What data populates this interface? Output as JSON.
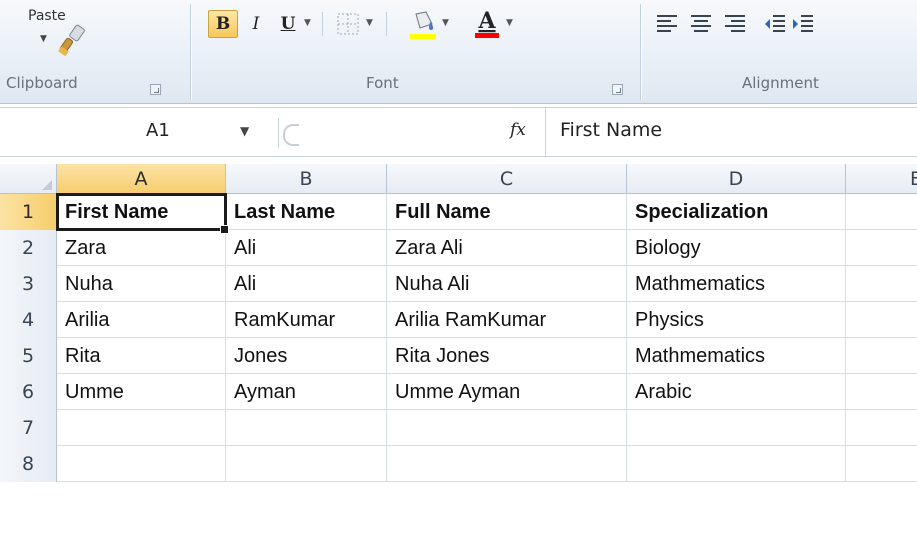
{
  "ribbon": {
    "clipboard": {
      "paste_label": "Paste",
      "group_label": "Clipboard"
    },
    "font": {
      "group_label": "Font",
      "bold": "B",
      "italic": "I",
      "underline": "U"
    },
    "alignment": {
      "group_label": "Alignment"
    },
    "icons": [
      "format-painter-icon",
      "borders-icon",
      "fill-color-icon",
      "font-color-icon",
      "align-left-icon",
      "align-center-icon",
      "align-right-icon",
      "decrease-indent-icon",
      "increase-indent-icon"
    ],
    "colors": {
      "fill_accent": "#ffff00",
      "font_color_accent": "#ff0000",
      "bold_active": "#f7c85b"
    }
  },
  "formula_bar": {
    "name_box": "A1",
    "fx_label": "fx",
    "value": "First Name"
  },
  "grid": {
    "columns": [
      "A",
      "B",
      "C",
      "D",
      "E"
    ],
    "active_column": "A",
    "active_row": "1",
    "rows": [
      {
        "num": "1",
        "cells": [
          "First Name",
          "Last Name",
          "Full Name",
          "Specialization"
        ]
      },
      {
        "num": "2",
        "cells": [
          "Zara",
          "Ali",
          "Zara Ali",
          "Biology"
        ]
      },
      {
        "num": "3",
        "cells": [
          "Nuha",
          "Ali",
          "Nuha Ali",
          "Mathmematics"
        ]
      },
      {
        "num": "4",
        "cells": [
          "Arilia",
          "RamKumar",
          "Arilia RamKumar",
          "Physics"
        ]
      },
      {
        "num": "5",
        "cells": [
          "Rita",
          "Jones",
          "Rita Jones",
          "Mathmematics"
        ]
      },
      {
        "num": "6",
        "cells": [
          "Umme",
          "Ayman",
          "Umme Ayman",
          "Arabic"
        ]
      },
      {
        "num": "7",
        "cells": [
          "",
          "",
          "",
          ""
        ]
      },
      {
        "num": "8",
        "cells": [
          "",
          "",
          "",
          ""
        ]
      }
    ]
  }
}
